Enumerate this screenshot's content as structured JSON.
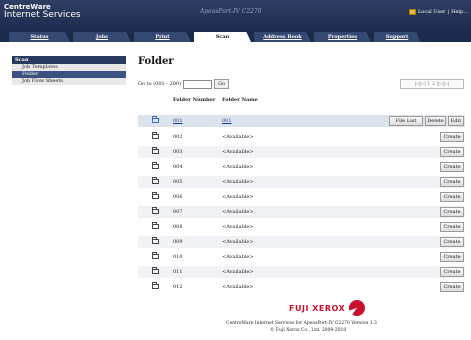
{
  "header": {
    "brand_line1": "CentreWare",
    "brand_line2": "Internet Services",
    "model": "ApeosPort-IV C2270",
    "user_label": "Local User",
    "help_label": "Help..."
  },
  "tabs": [
    {
      "label": "Status"
    },
    {
      "label": "Jobs"
    },
    {
      "label": "Print"
    },
    {
      "label": "Scan"
    },
    {
      "label": "Address Book"
    },
    {
      "label": "Properties"
    },
    {
      "label": "Support"
    }
  ],
  "leftnav": {
    "section": "Scan",
    "items": [
      {
        "label": "Job Templates"
      },
      {
        "label": "Folder"
      },
      {
        "label": "Job Flow Sheets"
      }
    ]
  },
  "main": {
    "title": "Folder",
    "goto_label": "Go to (001 - 200)",
    "goto_value": "",
    "go_button": "Go",
    "pager_text": "|◁|◁ 1 2 |▷|▷|",
    "col_number": "Folder Number",
    "col_name": "Folder Name",
    "btn_file_list": "File List",
    "btn_delete": "Delete",
    "btn_edit": "Edit",
    "btn_create": "Create",
    "rows": [
      {
        "num": "001",
        "name": "001"
      },
      {
        "num": "002",
        "name": "<Available>"
      },
      {
        "num": "003",
        "name": "<Available>"
      },
      {
        "num": "004",
        "name": "<Available>"
      },
      {
        "num": "005",
        "name": "<Available>"
      },
      {
        "num": "006",
        "name": "<Available>"
      },
      {
        "num": "007",
        "name": "<Available>"
      },
      {
        "num": "008",
        "name": "<Available>"
      },
      {
        "num": "009",
        "name": "<Available>"
      },
      {
        "num": "010",
        "name": "<Available>"
      },
      {
        "num": "011",
        "name": "<Available>"
      },
      {
        "num": "012",
        "name": "<Available>"
      }
    ]
  },
  "footer": {
    "logo_text": "FUJI XEROX",
    "line1": "CentreWare Internet Services for ApeosPort-IV C2270 Version 1.3",
    "line2": "© Fuji Xerox Co., Ltd. 2009-2010"
  },
  "colors": {
    "header_bg": "#1c2a4c",
    "selected_nav": "#3b5180",
    "brand_red": "#c8102e"
  }
}
